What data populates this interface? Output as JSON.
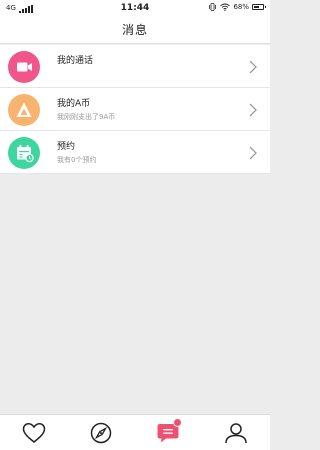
{
  "status_bar": {
    "network": "4G",
    "time": "11:44",
    "battery_text": "68%",
    "battery_level": 0.68
  },
  "header": {
    "title": "消息"
  },
  "list": [
    {
      "title": "我的通话",
      "subtitle": "",
      "icon": "video-call-icon",
      "color": "#f0568a"
    },
    {
      "title": "我的A币",
      "subtitle": "我刚刚支出了9A币",
      "icon": "a-coin-icon",
      "color": "#f8b46c"
    },
    {
      "title": "预约",
      "subtitle": "我有0个预约",
      "icon": "calendar-icon",
      "color": "#3ed6a0"
    }
  ],
  "tabs": [
    {
      "name": "tab-favorites",
      "icon": "heart-icon"
    },
    {
      "name": "tab-discover",
      "icon": "compass-icon"
    },
    {
      "name": "tab-messages",
      "icon": "chat-icon",
      "active": true,
      "badge": true,
      "active_color": "#f0506e"
    },
    {
      "name": "tab-profile",
      "icon": "person-icon"
    }
  ]
}
